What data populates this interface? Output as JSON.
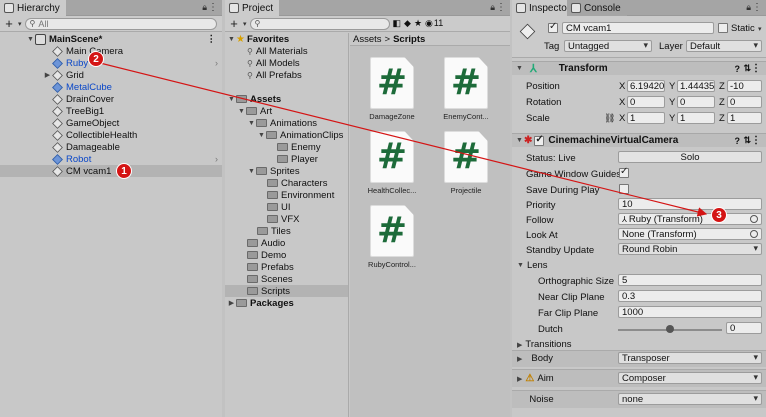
{
  "hierarchy": {
    "tab_label": "Hierarchy",
    "search_placeholder": "All",
    "scene_name": "MainScene*",
    "items": [
      {
        "label": "Main Camera"
      },
      {
        "label": "Ruby"
      },
      {
        "label": "Grid"
      },
      {
        "label": "MetalCube"
      },
      {
        "label": "DrainCover"
      },
      {
        "label": "TreeBig1"
      },
      {
        "label": "GameObject"
      },
      {
        "label": "CollectibleHealth"
      },
      {
        "label": "Damageable"
      },
      {
        "label": "Robot"
      },
      {
        "label": "CM vcam1"
      }
    ]
  },
  "project": {
    "tab_label": "Project",
    "counter": "11",
    "favorites_label": "Favorites",
    "favorites": [
      "All Materials",
      "All Models",
      "All Prefabs"
    ],
    "tree": {
      "assets": "Assets",
      "art": "Art",
      "animations": "Animations",
      "animation_clips": "AnimationClips",
      "enemy": "Enemy",
      "player": "Player",
      "sprites": "Sprites",
      "characters": "Characters",
      "environment": "Environment",
      "ui": "UI",
      "vfx": "VFX",
      "tiles": "Tiles",
      "audio": "Audio",
      "demo": "Demo",
      "prefabs": "Prefabs",
      "scenes": "Scenes",
      "scripts": "Scripts",
      "packages": "Packages"
    },
    "breadcrumb": {
      "root": "Assets",
      "separator": ">",
      "current": "Scripts"
    },
    "scripts": [
      "DamageZone",
      "EnemyCont...",
      "HealthCollec...",
      "Projectile",
      "RubyControl..."
    ]
  },
  "inspector": {
    "tab_label": "Inspector",
    "console_tab_label": "Console",
    "object_name": "CM vcam1",
    "static_label": "Static",
    "tag_label": "Tag",
    "tag_value": "Untagged",
    "layer_label": "Layer",
    "layer_value": "Default",
    "transform": {
      "title": "Transform",
      "position_label": "Position",
      "rotation_label": "Rotation",
      "scale_label": "Scale",
      "axis_x": "X",
      "axis_y": "Y",
      "axis_z": "Z",
      "position": [
        "6.19420",
        "1.44435",
        "-10"
      ],
      "rotation": [
        "0",
        "0",
        "0"
      ],
      "scale": [
        "1",
        "1",
        "1"
      ]
    },
    "cinemachine": {
      "title": "CinemachineVirtualCamera",
      "status_label": "Status: Live",
      "solo_label": "Solo",
      "game_window_guides_label": "Game Window Guides",
      "save_during_play_label": "Save During Play",
      "priority_label": "Priority",
      "priority_value": "10",
      "follow_label": "Follow",
      "follow_value": "Ruby (Transform)",
      "look_at_label": "Look At",
      "look_at_value": "None (Transform)",
      "standby_update_label": "Standby Update",
      "standby_update_value": "Round Robin",
      "lens_label": "Lens",
      "ortho_size_label": "Orthographic Size",
      "ortho_size_value": "5",
      "near_clip_label": "Near Clip Plane",
      "near_clip_value": "0.3",
      "far_clip_label": "Far Clip Plane",
      "far_clip_value": "1000",
      "dutch_label": "Dutch",
      "dutch_value": "0",
      "transitions_label": "Transitions",
      "body_label": "Body",
      "body_value": "Transposer",
      "aim_label": "Aim",
      "aim_value": "Composer",
      "noise_label": "Noise",
      "noise_value": "none"
    }
  },
  "annotations": {
    "badge_1": "1",
    "badge_2": "2",
    "badge_3": "3",
    "color": "#d41414"
  }
}
